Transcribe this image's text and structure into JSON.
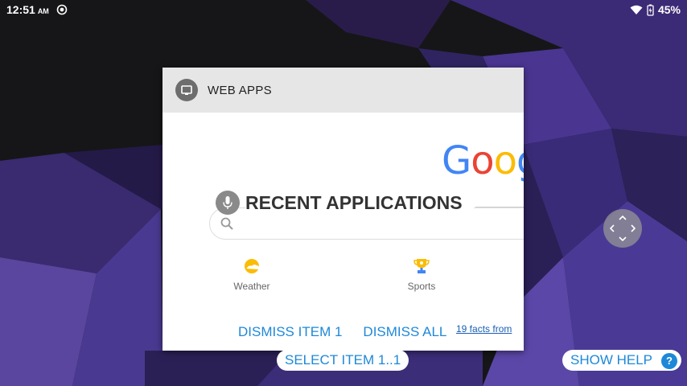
{
  "status_bar": {
    "time": "12:51",
    "ampm": "AM",
    "battery": "45%",
    "icons": [
      "sync-icon",
      "wifi-icon",
      "battery-charging-icon"
    ]
  },
  "card": {
    "header_title": "WEB APPS",
    "header_icon": "monitor-icon",
    "logo_text": "Goog",
    "section_title": "RECENT APPLICATIONS",
    "section_icon": "microphone-icon",
    "search_icon": "search-icon",
    "shortcuts": [
      {
        "label": "Weather",
        "icon": "weather-icon"
      },
      {
        "label": "Sports",
        "icon": "trophy-icon"
      }
    ],
    "link_text": "19 facts from"
  },
  "actions": {
    "dismiss_item": "DISMISS ITEM 1",
    "dismiss_all": "DISMISS ALL",
    "select_item": "SELECT ITEM 1..1",
    "show_help": "SHOW HELP",
    "help_glyph": "?"
  },
  "colors": {
    "accent": "#1e88d8",
    "google_blue": "#4285f4",
    "google_red": "#ea4335",
    "google_yellow": "#fbbc05"
  }
}
